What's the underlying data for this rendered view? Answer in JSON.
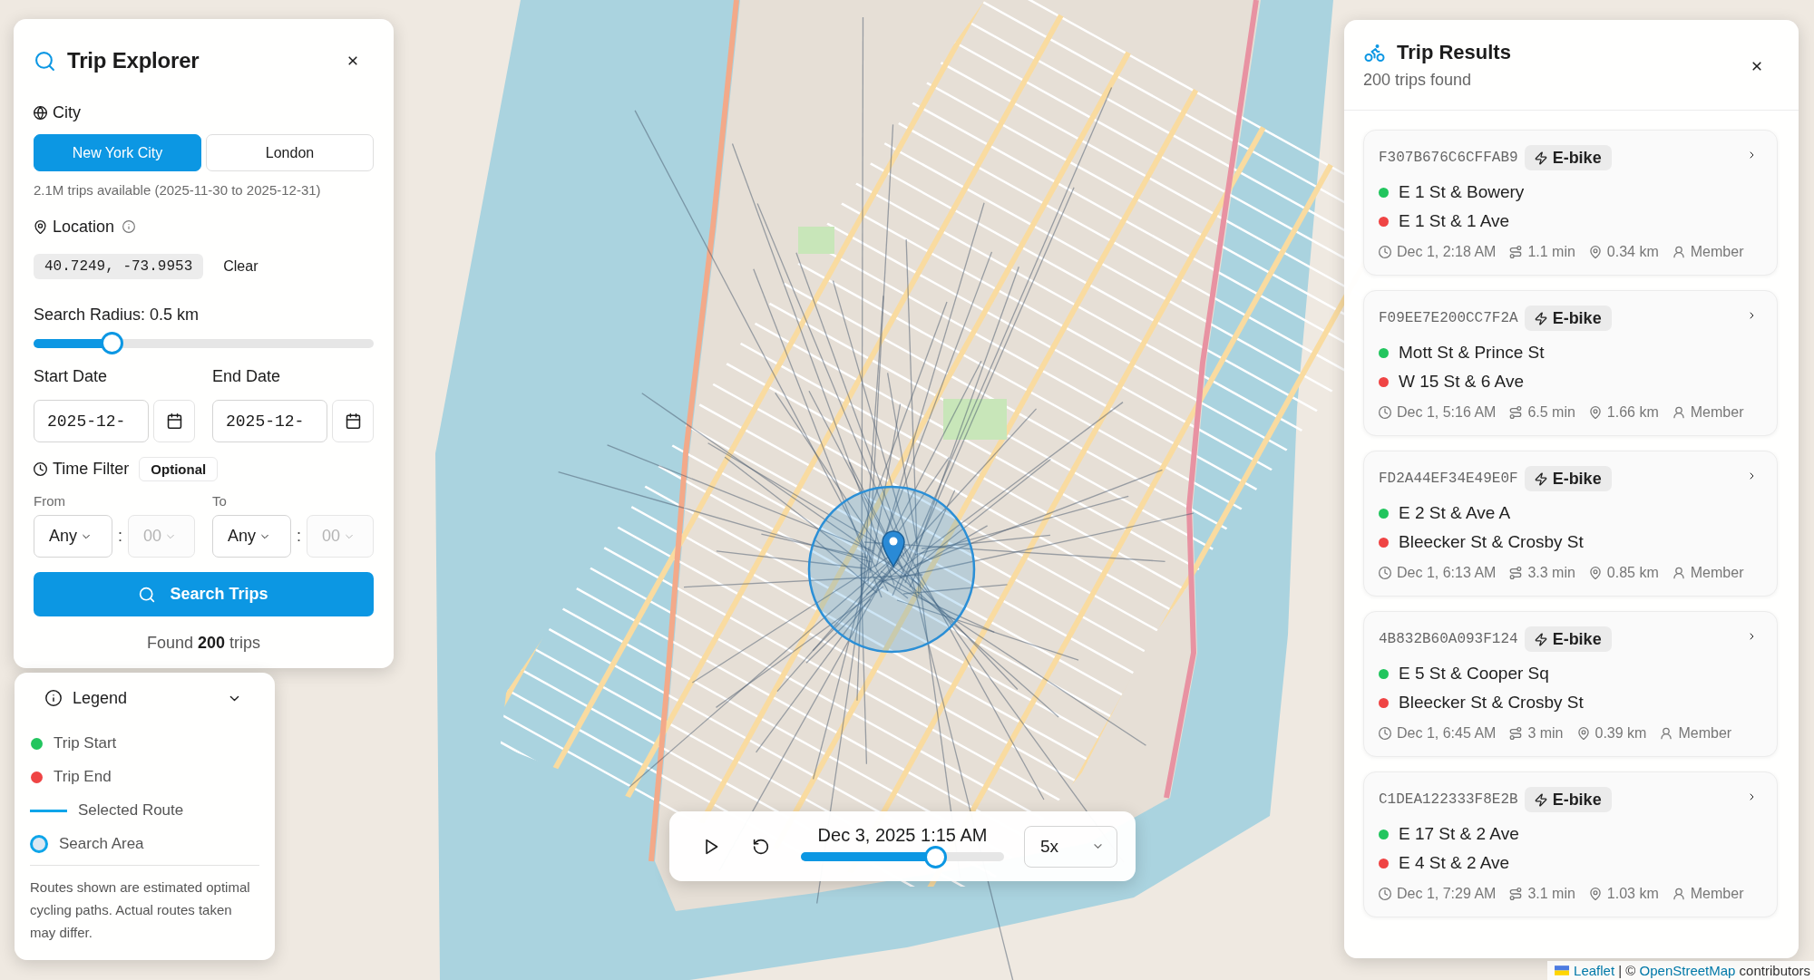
{
  "search_panel": {
    "title": "Trip Explorer",
    "city": {
      "label": "City",
      "options": [
        {
          "label": "New York City",
          "selected": true
        },
        {
          "label": "London",
          "selected": false
        }
      ],
      "availability": "2.1M trips available (2025-11-30 to 2025-12-31)"
    },
    "location": {
      "label": "Location",
      "coordinates": "40.7249, -73.9953",
      "clear": "Clear"
    },
    "radius": {
      "label": "Search Radius: 0.5 km",
      "level": 0.23
    },
    "dates": [
      {
        "label": "Start Date",
        "value": "2025-12-"
      },
      {
        "label": "End Date",
        "value": "2025-12-"
      }
    ],
    "time_filter": {
      "label": "Time Filter",
      "badge": "Optional",
      "ranges": [
        {
          "label": "From",
          "hour": {
            "value": "Any",
            "disabled": false
          },
          "separator": ":",
          "minute": {
            "value": "00",
            "disabled": true
          }
        },
        {
          "label": "To",
          "hour": {
            "value": "Any",
            "disabled": false
          },
          "separator": ":",
          "minute": {
            "value": "00",
            "disabled": true
          }
        }
      ]
    },
    "search_button": "Search Trips",
    "summary": "Found **200** trips"
  },
  "legend": {
    "title": "Legend",
    "expanded": true,
    "items": [
      {
        "kind": "dot",
        "label": "Trip Start",
        "color": "#22c55e"
      },
      {
        "kind": "dot",
        "label": "Trip End",
        "color": "#ef4444"
      },
      {
        "kind": "line",
        "label": "Selected Route",
        "color": "#0ea5e9"
      },
      {
        "kind": "ring",
        "label": "Search Area",
        "color": "#0ea5e9"
      }
    ],
    "note": "Routes shown are estimated optimal cycling paths. Actual routes taken may differ."
  },
  "playback": {
    "time": "Dec 3, 2025 1:15 AM",
    "level": 0.665,
    "speed": "5x"
  },
  "results": {
    "title": "Trip Results",
    "count": "200 trips found",
    "trips": [
      {
        "id": "F307B676C6CFFAB9",
        "type": "E-bike",
        "start": "E 1 St & Bowery",
        "end": "E 1 St & 1 Ave",
        "time": "Dec 1, 2:18 AM",
        "duration": "1.1 min",
        "distance": "0.34 km",
        "rider": "Member"
      },
      {
        "id": "F09EE7E200CC7F2A",
        "type": "E-bike",
        "start": "Mott St & Prince St",
        "end": "W 15 St & 6 Ave",
        "time": "Dec 1, 5:16 AM",
        "duration": "6.5 min",
        "distance": "1.66 km",
        "rider": "Member"
      },
      {
        "id": "FD2A44EF34E49E0F",
        "type": "E-bike",
        "start": "E 2 St & Ave A",
        "end": "Bleecker St & Crosby St",
        "time": "Dec 1, 6:13 AM",
        "duration": "3.3 min",
        "distance": "0.85 km",
        "rider": "Member"
      },
      {
        "id": "4B832B60A093F124",
        "type": "E-bike",
        "start": "E 5 St & Cooper Sq",
        "end": "Bleecker St & Crosby St",
        "time": "Dec 1, 6:45 AM",
        "duration": "3 min",
        "distance": "0.39 km",
        "rider": "Member"
      },
      {
        "id": "C1DEA122333F8E2B",
        "type": "E-bike",
        "start": "E 17 St & 2 Ave",
        "end": "E 4 St & 2 Ave",
        "time": "Dec 1, 7:29 AM",
        "duration": "3.1 min",
        "distance": "1.03 km",
        "rider": "Member"
      }
    ]
  },
  "attribution": {
    "parts": [
      {
        "kind": "link",
        "text": "Leaflet"
      },
      {
        "kind": "text",
        "text": " | © "
      },
      {
        "kind": "link",
        "text": "OpenStreetMap"
      },
      {
        "kind": "text",
        "text": " contributors"
      }
    ]
  }
}
